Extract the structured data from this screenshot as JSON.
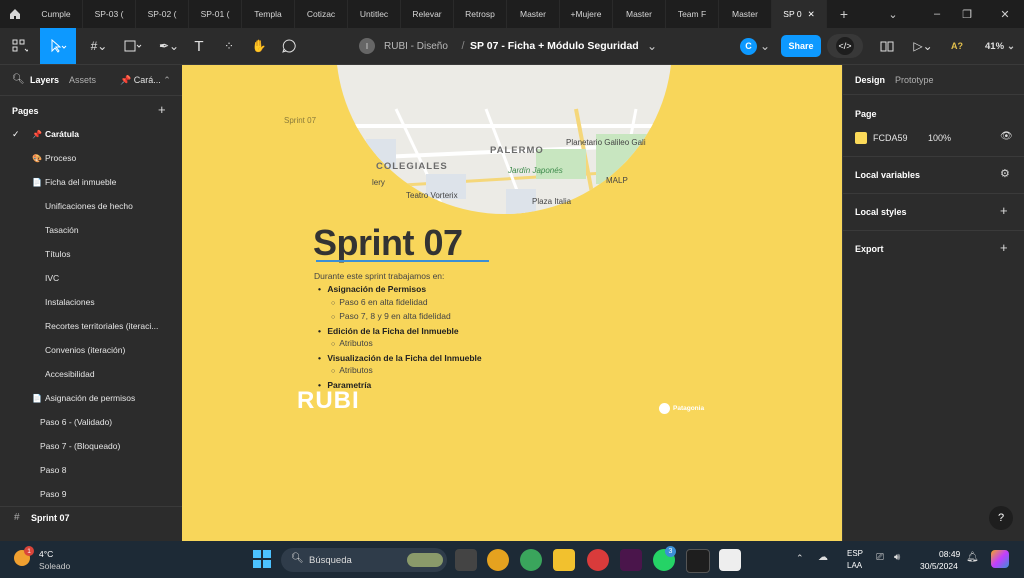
{
  "tabs": [
    "Cumple",
    "SP-03 (",
    "SP-02 (",
    "SP-01 (",
    "Templa",
    "Cotizac",
    "Untitlec",
    "Relevar",
    "Retrosp",
    "Master",
    "+Mujere",
    "Master",
    "Team F",
    "Master",
    "SP 0"
  ],
  "toolbar": {
    "breadcrumb_team": "RUBI - Diseño",
    "breadcrumb_sep": "/",
    "file_name": "SP 07 - Ficha + Módulo Seguridad",
    "avatar_letter": "C",
    "share_label": "Share",
    "zoom": "41%",
    "a_badge": "A?"
  },
  "left": {
    "tab_layers": "Layers",
    "tab_assets": "Assets",
    "page_selector": "Cará...",
    "pages_heading": "Pages",
    "pages": [
      {
        "label": "Carátula",
        "prefix": "📌",
        "checked": true
      },
      {
        "label": "Proceso",
        "prefix": "🎨",
        "checked": false
      },
      {
        "label": "Ficha del inmueble",
        "prefix": "📄",
        "checked": false
      },
      {
        "label": "Unificaciones de hecho",
        "prefix": "",
        "checked": false
      },
      {
        "label": "Tasación",
        "prefix": "",
        "checked": false
      },
      {
        "label": "Títulos",
        "prefix": "",
        "checked": false
      },
      {
        "label": "IVC",
        "prefix": "",
        "checked": false
      },
      {
        "label": "Instalaciones",
        "prefix": "",
        "checked": false
      },
      {
        "label": "Recortes territoriales (iteraci...",
        "prefix": "",
        "checked": false
      },
      {
        "label": "Convenios (iteración)",
        "prefix": "",
        "checked": false
      },
      {
        "label": "Accesibilidad",
        "prefix": "",
        "checked": false
      },
      {
        "label": "Asignación de permisos",
        "prefix": "📄",
        "checked": false
      },
      {
        "label": "Paso 6 -  (Validado)",
        "prefix": "",
        "checked": false
      },
      {
        "label": "Paso 7 -  (Bloqueado)",
        "prefix": "",
        "checked": false
      },
      {
        "label": "Paso 8",
        "prefix": "",
        "checked": false
      },
      {
        "label": "Paso 9",
        "prefix": "",
        "checked": false
      }
    ],
    "frame_label": "Sprint 07"
  },
  "canvas": {
    "frame_name": "Sprint 07",
    "map_labels": [
      "PALERMO",
      "COLEGIALES",
      "Jardín Japonés",
      "Planetario Galileo Gali",
      "MALP",
      "Teatro Vorterix",
      "Plaza Italia",
      "lery"
    ],
    "title": "Sprint 07",
    "intro": "Durante este sprint trabajamos en:",
    "bullets": [
      {
        "label": "Asignación de Permisos",
        "subs": [
          "Paso 6 en alta fidelidad",
          "Paso 7, 8 y 9 en alta fidelidad"
        ]
      },
      {
        "label": "Edición de la Ficha del Inmueble",
        "subs": [
          "Atributos"
        ]
      },
      {
        "label": "Visualización de la Ficha del Inmueble",
        "subs": [
          "Atributos"
        ]
      },
      {
        "label": "Parametría",
        "subs": []
      }
    ],
    "logo_rubi": "RUBI",
    "logo_patagonia": "Patagonia",
    "bg_color": "#F8D65A"
  },
  "right": {
    "tab_design": "Design",
    "tab_prototype": "Prototype",
    "page_heading": "Page",
    "page_color_hex": "FCDA59",
    "page_opacity": "100%",
    "local_variables": "Local variables",
    "local_styles": "Local styles",
    "export": "Export",
    "help": "?"
  },
  "taskbar": {
    "temp": "4°C",
    "weather": "Soleado",
    "weather_badge": "1",
    "search": "Búsqueda",
    "lang1": "ESP",
    "lang2": "LAA",
    "time": "08:49",
    "date": "30/5/2024",
    "badge_whatsapp": "3"
  },
  "colors": {
    "accent": "#0d99ff",
    "canvas_bg": "#F8D65A",
    "title_underline": "#3b8fd6"
  }
}
